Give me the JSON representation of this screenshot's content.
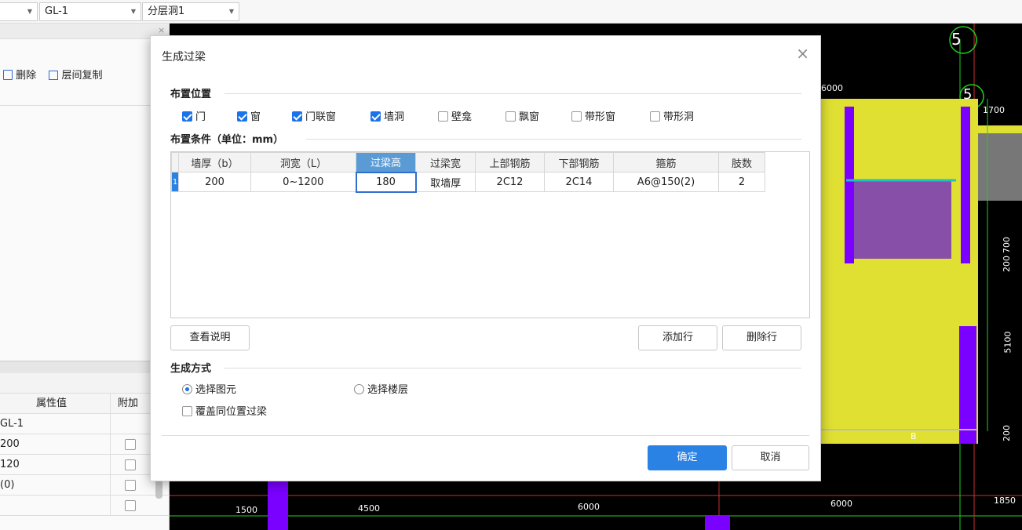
{
  "toolbar": {
    "combo1": "GL-1",
    "combo2": "分层洞1"
  },
  "left_panel": {
    "delete_label": "删除",
    "copy_label": "层间复制",
    "prop_headers": {
      "value": "属性值",
      "extra": "附加"
    },
    "props": [
      {
        "value": "GL-1",
        "extra": false,
        "show_cb": false
      },
      {
        "value": "200",
        "extra": false,
        "show_cb": true
      },
      {
        "value": "120",
        "extra": false,
        "show_cb": true
      },
      {
        "value": "(0)",
        "extra": false,
        "show_cb": true
      },
      {
        "value": "",
        "extra": false,
        "show_cb": true
      }
    ]
  },
  "dialog": {
    "title": "生成过梁",
    "section_position": "布置位置",
    "checkboxes": [
      {
        "label": "门",
        "checked": true
      },
      {
        "label": "窗",
        "checked": true
      },
      {
        "label": "门联窗",
        "checked": true
      },
      {
        "label": "墙洞",
        "checked": true
      },
      {
        "label": "壁龛",
        "checked": false
      },
      {
        "label": "飘窗",
        "checked": false
      },
      {
        "label": "带形窗",
        "checked": false
      },
      {
        "label": "带形洞",
        "checked": false
      }
    ],
    "section_conditions": "布置条件（单位：mm）",
    "table": {
      "headers": [
        "墙厚（b）",
        "洞宽（L）",
        "过梁高",
        "过梁宽",
        "上部钢筋",
        "下部钢筋",
        "箍筋",
        "肢数"
      ],
      "rows": [
        {
          "num": "1",
          "cells": [
            "200",
            "0~1200",
            "180",
            "取墙厚",
            "2C12",
            "2C14",
            "A6@150(2)",
            "2"
          ]
        }
      ]
    },
    "view_desc_btn": "查看说明",
    "add_row_btn": "添加行",
    "delete_row_btn": "删除行",
    "section_method": "生成方式",
    "radio_select_elements": "选择图元",
    "radio_select_floor": "选择楼层",
    "override_label": "覆盖同位置过梁",
    "ok_btn": "确定",
    "cancel_btn": "取消"
  },
  "cad": {
    "axis_labels": [
      "5",
      "5"
    ],
    "dims": [
      "6000",
      "1700",
      "1500",
      "4500",
      "6000",
      "6000",
      "1850",
      "700",
      "200",
      "5100",
      "200",
      "B"
    ]
  }
}
